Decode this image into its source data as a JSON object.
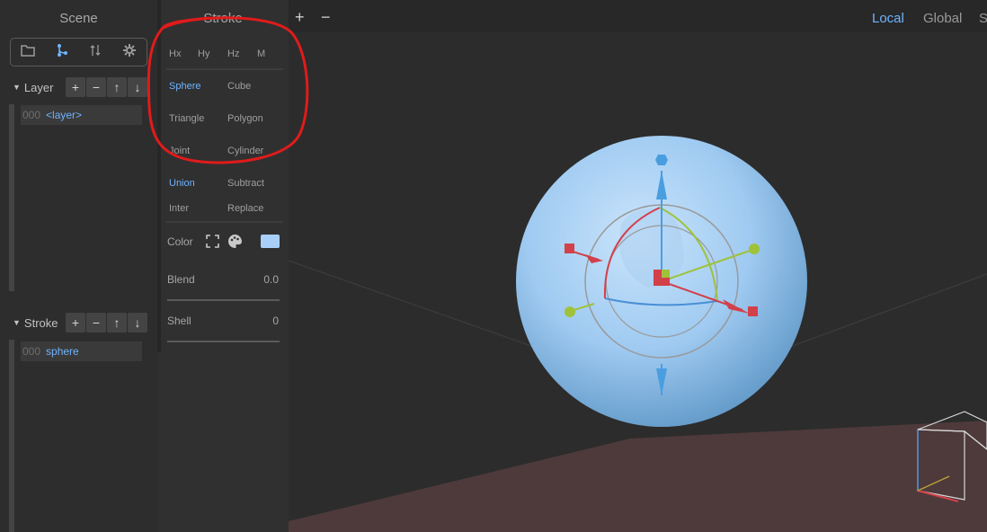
{
  "scene": {
    "title": "Scene",
    "toolbar_icons": [
      "folder-icon",
      "hierarchy-icon",
      "sort-icon",
      "gear-icon"
    ],
    "layer_section": {
      "label": "Layer",
      "items": [
        {
          "index": "000",
          "name": "<layer>"
        }
      ]
    },
    "stroke_section": {
      "label": "Stroke",
      "items": [
        {
          "index": "000",
          "name": "sphere"
        }
      ]
    },
    "list_buttons": [
      "+",
      "−",
      "↑",
      "↓"
    ]
  },
  "stroke": {
    "title": "Stroke",
    "axis_tabs": [
      "Hx",
      "Hy",
      "Hz",
      "M"
    ],
    "shapes": [
      "Sphere",
      "Cube",
      "Triangle",
      "Polygon",
      "Joint",
      "Cylinder"
    ],
    "selected_shape": "Sphere",
    "operations": [
      "Union",
      "Subtract",
      "Inter",
      "Replace"
    ],
    "selected_operation": "Union",
    "color_label": "Color",
    "color_swatch": "#a8cff7",
    "blend_label": "Blend",
    "blend_value": "0.0",
    "shell_label": "Shell",
    "shell_value": "0"
  },
  "viewport": {
    "add": "+",
    "remove": "−",
    "modes": [
      "Local",
      "Global",
      "S"
    ],
    "active_mode": "Local",
    "accent": "#6fb4ff"
  },
  "annotation_color": "#e01b1b"
}
